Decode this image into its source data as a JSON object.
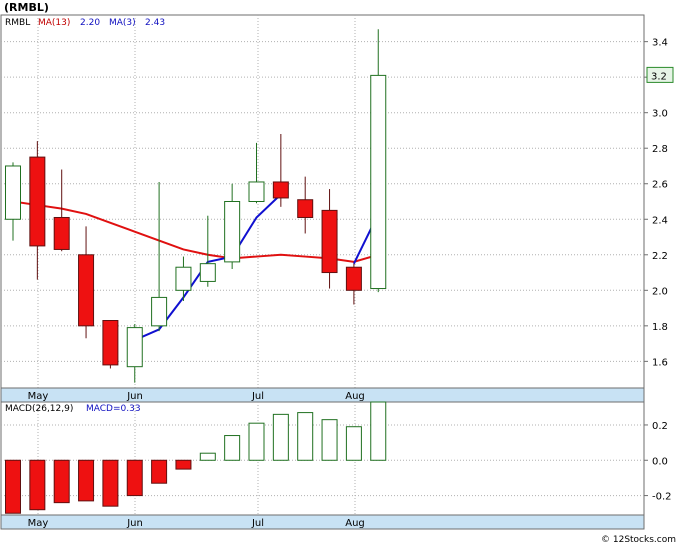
{
  "title": "(RMBL)",
  "footer": "© 12Stocks.com",
  "chart_data": [
    {
      "type": "candlestick",
      "legend": {
        "symbol": "RMBL",
        "ma13_label": "MA(13)",
        "ma13_value": "2.20",
        "ma3_label": "MA(3)",
        "ma3_value": "2.43"
      },
      "y_ticks": [
        1.6,
        1.8,
        2.0,
        2.2,
        2.4,
        2.6,
        2.8,
        3.0,
        3.2,
        3.4
      ],
      "y_tick_labels": [
        "1.6",
        "1.8",
        "2.0",
        "2.2",
        "2.4",
        "2.6",
        "2.8",
        "3.0",
        "3.2",
        "3.4"
      ],
      "ylim": [
        1.45,
        3.55
      ],
      "last_price_label": "3.2",
      "x_labels": [
        "May",
        "Jun",
        "Jul",
        "Aug"
      ],
      "candles": [
        {
          "o": 2.4,
          "h": 2.72,
          "l": 2.28,
          "c": 2.7
        },
        {
          "o": 2.75,
          "h": 2.84,
          "l": 2.06,
          "c": 2.25
        },
        {
          "o": 2.41,
          "h": 2.68,
          "l": 2.22,
          "c": 2.23
        },
        {
          "o": 2.2,
          "h": 2.36,
          "l": 1.73,
          "c": 1.8
        },
        {
          "o": 1.83,
          "h": 1.83,
          "l": 1.56,
          "c": 1.58
        },
        {
          "o": 1.57,
          "h": 1.81,
          "l": 1.48,
          "c": 1.79
        },
        {
          "o": 1.8,
          "h": 2.61,
          "l": 1.77,
          "c": 1.96
        },
        {
          "o": 2.0,
          "h": 2.19,
          "l": 1.94,
          "c": 2.13
        },
        {
          "o": 2.05,
          "h": 2.42,
          "l": 2.02,
          "c": 2.15
        },
        {
          "o": 2.16,
          "h": 2.6,
          "l": 2.12,
          "c": 2.5
        },
        {
          "o": 2.5,
          "h": 2.83,
          "l": 2.49,
          "c": 2.61
        },
        {
          "o": 2.61,
          "h": 2.88,
          "l": 2.47,
          "c": 2.52
        },
        {
          "o": 2.51,
          "h": 2.64,
          "l": 2.32,
          "c": 2.41
        },
        {
          "o": 2.45,
          "h": 2.57,
          "l": 2.01,
          "c": 2.1
        },
        {
          "o": 2.13,
          "h": 2.15,
          "l": 1.92,
          "c": 2.0
        },
        {
          "o": 2.01,
          "h": 3.47,
          "l": 1.99,
          "c": 3.21
        }
      ],
      "ma13": [
        2.5,
        2.48,
        2.46,
        2.43,
        2.38,
        2.33,
        2.28,
        2.23,
        2.2,
        2.18,
        2.19,
        2.2,
        2.19,
        2.18,
        2.16,
        2.2
      ],
      "ma3_series": [
        null,
        null,
        null,
        null,
        null,
        1.72,
        1.78,
        1.96,
        2.16,
        2.19,
        2.41,
        2.54,
        null,
        null,
        2.15,
        2.43
      ]
    },
    {
      "type": "bar",
      "legend": {
        "label": "MACD(26,12,9)",
        "value_label": "MACD=0.33"
      },
      "y_ticks": [
        0.2,
        0.0,
        -0.2
      ],
      "y_tick_labels": [
        "0.2",
        "0.0",
        "-0.2"
      ],
      "ylim": [
        -0.31,
        0.33
      ],
      "x_labels": [
        "May",
        "Jun",
        "Jul",
        "Aug"
      ],
      "values": [
        -0.3,
        -0.28,
        -0.24,
        -0.23,
        -0.26,
        -0.2,
        -0.13,
        -0.05,
        0.04,
        0.14,
        0.21,
        0.26,
        0.27,
        0.23,
        0.19,
        0.33
      ]
    }
  ]
}
